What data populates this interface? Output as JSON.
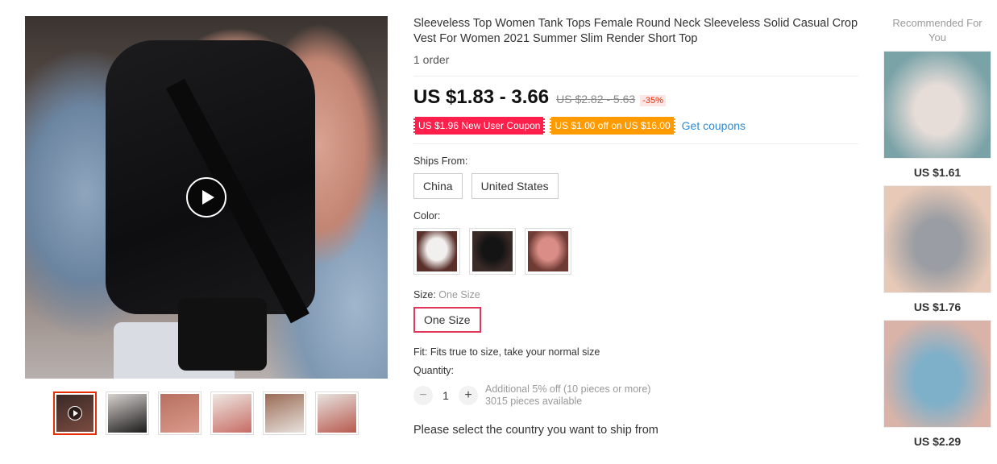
{
  "gallery": {
    "main_image_alt": "woman in black sleeveless tank top",
    "thumbnails": [
      {
        "id": "t1",
        "active": true,
        "has_video": true,
        "colors": [
          "#3b2a26",
          "#7a4b40"
        ]
      },
      {
        "id": "t2",
        "active": false,
        "has_video": false,
        "colors": [
          "#d8d2cf",
          "#1b1b1b"
        ]
      },
      {
        "id": "t3",
        "active": false,
        "has_video": false,
        "colors": [
          "#b87060",
          "#d99a8c"
        ]
      },
      {
        "id": "t4",
        "active": false,
        "has_video": false,
        "colors": [
          "#eee7e2",
          "#c76c64"
        ]
      },
      {
        "id": "t5",
        "active": false,
        "has_video": false,
        "colors": [
          "#9a6b55",
          "#e8e2dd"
        ]
      },
      {
        "id": "t6",
        "active": false,
        "has_video": false,
        "colors": [
          "#e7e3e0",
          "#b85a4e"
        ]
      }
    ]
  },
  "product": {
    "title": "Sleeveless Top Women Tank Tops Female Round Neck Sleeveless Solid Casual Crop Vest For Women 2021 Summer Slim Render Short Top",
    "orders": "1 order",
    "price": "US $1.83 - 3.66",
    "original_price": "US $2.82 - 5.63",
    "discount": "-35%",
    "coupons": [
      {
        "text": "US $1.96 New User Coupon",
        "color": "#ff1f4b"
      },
      {
        "text": "US $1.00 off on US $16.00",
        "color": "#ff9a00"
      }
    ],
    "get_coupons": "Get coupons",
    "ships_from_label": "Ships From:",
    "ships_from_options": [
      "China",
      "United States"
    ],
    "color_label": "Color:",
    "color_swatches": [
      {
        "colors": [
          "#5a2f2a",
          "#f2f0ee"
        ]
      },
      {
        "colors": [
          "#3a2a28",
          "#141414"
        ]
      },
      {
        "colors": [
          "#6e3a34",
          "#d98d86"
        ]
      }
    ],
    "size_label": "Size:",
    "size_selected": "One Size",
    "size_options": [
      "One Size"
    ],
    "fit": "Fit: Fits true to size, take your normal size",
    "quantity_label": "Quantity:",
    "quantity": "1",
    "qty_minus": "−",
    "qty_plus": "+",
    "quantity_note_1": "Additional 5% off (10 pieces or more)",
    "quantity_note_2": "3015 pieces available",
    "ship_message": "Please select the country you want to ship from"
  },
  "recommended": {
    "title": "Recommended For You",
    "items": [
      {
        "price": "US $1.61",
        "colors": [
          "#7aa3a8",
          "#e6dcd8"
        ]
      },
      {
        "price": "US $1.76",
        "colors": [
          "#e7c9b7",
          "#9a9da3"
        ]
      },
      {
        "price": "US $2.29",
        "colors": [
          "#d9b3a8",
          "#7fb0c9"
        ]
      }
    ]
  },
  "accent": "#e62e04",
  "select_border": "#e0365a"
}
